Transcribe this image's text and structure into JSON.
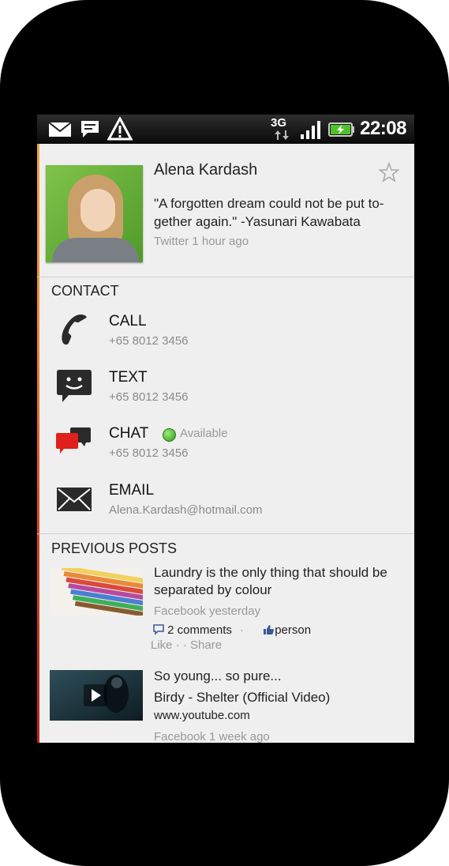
{
  "status_bar": {
    "network": "3G",
    "time": "22:08",
    "icons": [
      "mail-icon",
      "message-icon",
      "warning-icon",
      "signal-icon",
      "battery-charging-icon"
    ]
  },
  "profile": {
    "name": "Alena Kardash",
    "quote": "\"A forgotten dream could not be put to-gether again.\" -Yasunari Kawabata",
    "source": "Twitter 1 hour ago"
  },
  "contact": {
    "title": "CONTACT",
    "items": [
      {
        "label": "CALL",
        "value": "+65 8012 3456",
        "icon": "phone-icon"
      },
      {
        "label": "TEXT",
        "value": "+65 8012 3456",
        "icon": "sms-icon"
      },
      {
        "label": "CHAT",
        "value": "+65 8012 3456",
        "icon": "chat-icon",
        "status": "Available"
      },
      {
        "label": "EMAIL",
        "value": "Alena.Kardash@hotmail.com",
        "icon": "envelope-icon"
      }
    ]
  },
  "posts": {
    "title": "PREVIOUS POSTS",
    "items": [
      {
        "text": "Laundry is the only thing that should be separated by colour",
        "meta": "Facebook yesterday",
        "comments": "2 comments",
        "like_person": "person",
        "like": "Like",
        "share": "Share"
      },
      {
        "line1": "So young... so pure...",
        "line2": "Birdy - Shelter (Official Video)",
        "line3": "www.youtube.com",
        "meta": "Facebook 1 week ago"
      }
    ]
  },
  "colors": {
    "accent_top": "#f1a43a",
    "accent_bottom": "#c41e14",
    "available_green": "#2e9a1d",
    "secondary_text": "#999999"
  }
}
